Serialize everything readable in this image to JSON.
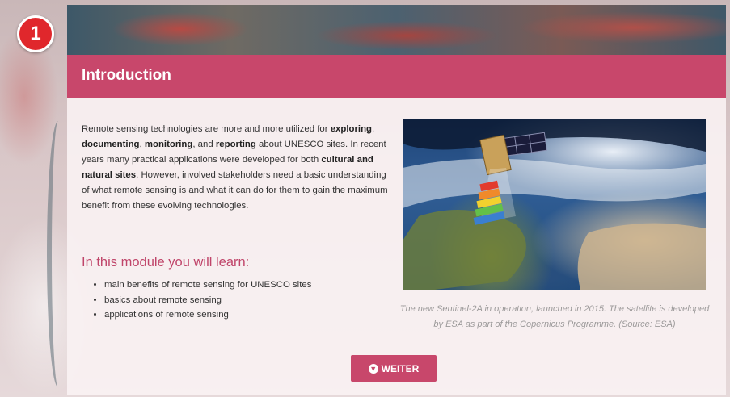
{
  "step": {
    "number": "1"
  },
  "header": {
    "title": "Introduction"
  },
  "intro": {
    "p1": "Remote sensing technologies are more and more utilized for ",
    "b1": "exploring",
    "s1": ", ",
    "b2": "documenting",
    "s2": ", ",
    "b3": "monitoring",
    "s3": ", and ",
    "b4": "reporting",
    "p2": " about UNESCO sites. In recent years many practical applications were developed for both ",
    "b5": "cultural and natural sites",
    "p3": ". However, involved stakeholders need a basic understanding of what remote sensing is and what it can do for them to gain the maximum benefit from these evolving technologies."
  },
  "learn": {
    "title": "In this module you will learn:",
    "items": [
      "main benefits of remote sensing for UNESCO sites",
      "basics about remote sensing",
      "applications of remote sensing"
    ]
  },
  "figure": {
    "caption": "The new Sentinel-2A in operation, launched in 2015. The satellite is developed by ESA as part of the Copernicus Programme. (Source: ESA)"
  },
  "button": {
    "label": "WEITER",
    "icon": "arrow-down-circle-icon"
  },
  "colors": {
    "accent": "#c8476b",
    "badge": "#e0272c"
  }
}
